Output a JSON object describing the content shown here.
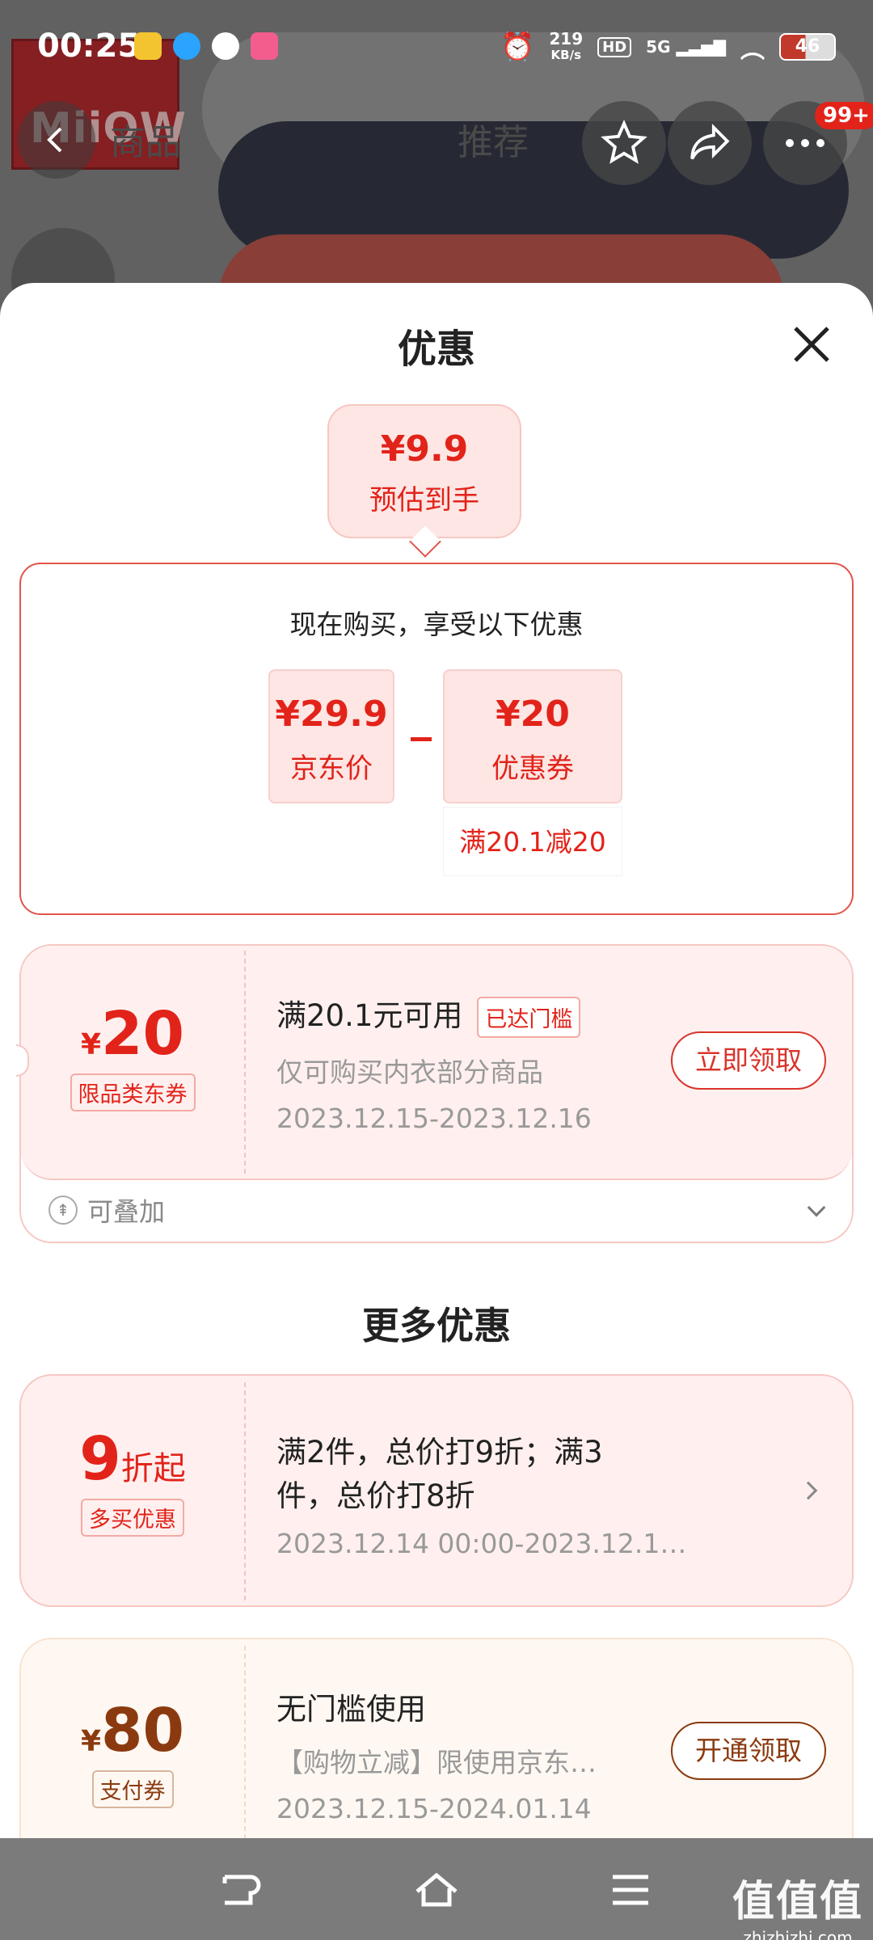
{
  "status_bar": {
    "time": "00:25",
    "net_speed_top": "219",
    "net_speed_unit": "KB/s",
    "hd": "HD",
    "signal": "5G",
    "battery": "46"
  },
  "background_page": {
    "logo_text": "MiiOW",
    "tab_product": "商品",
    "tab_recommend": "推荐",
    "badge": "99+"
  },
  "sheet": {
    "title": "优惠",
    "estimate": {
      "price": "¥9.9",
      "label": "预估到手"
    },
    "calc": {
      "heading": "现在购买，享受以下优惠",
      "jd_price": "¥29.9",
      "jd_price_label": "京东价",
      "coupon_value": "¥20",
      "coupon_label": "优惠券",
      "coupon_rule": "满20.1减20"
    },
    "coupon1": {
      "currency": "¥",
      "amount": "20",
      "tag": "限品类东券",
      "condition": "满20.1元可用",
      "reached": "已达门槛",
      "scope": "仅可购买内衣部分商品",
      "period": "2023.12.15-2023.12.16",
      "button": "立即领取",
      "stackable": "可叠加"
    },
    "more_title": "更多优惠",
    "coupon2": {
      "amount": "9",
      "unit": "折起",
      "tag": "多买优惠",
      "line1": "满2件，总价打9折；满3",
      "line2": "件，总价打8折",
      "period": "2023.12.14 00:00-2023.12.1…"
    },
    "coupon3": {
      "currency": "¥",
      "amount": "80",
      "tag": "支付券",
      "condition": "无门槛使用",
      "scope": "【购物立减】限使用京东…",
      "period": "2023.12.15-2024.01.14",
      "button": "开通领取"
    }
  },
  "watermark": {
    "main": "值值值",
    "site": "zhizhizhi.com"
  },
  "colors": {
    "accent": "#e2231a",
    "brown": "#8b3a0f",
    "nav_bg": "#7b7b7b"
  }
}
